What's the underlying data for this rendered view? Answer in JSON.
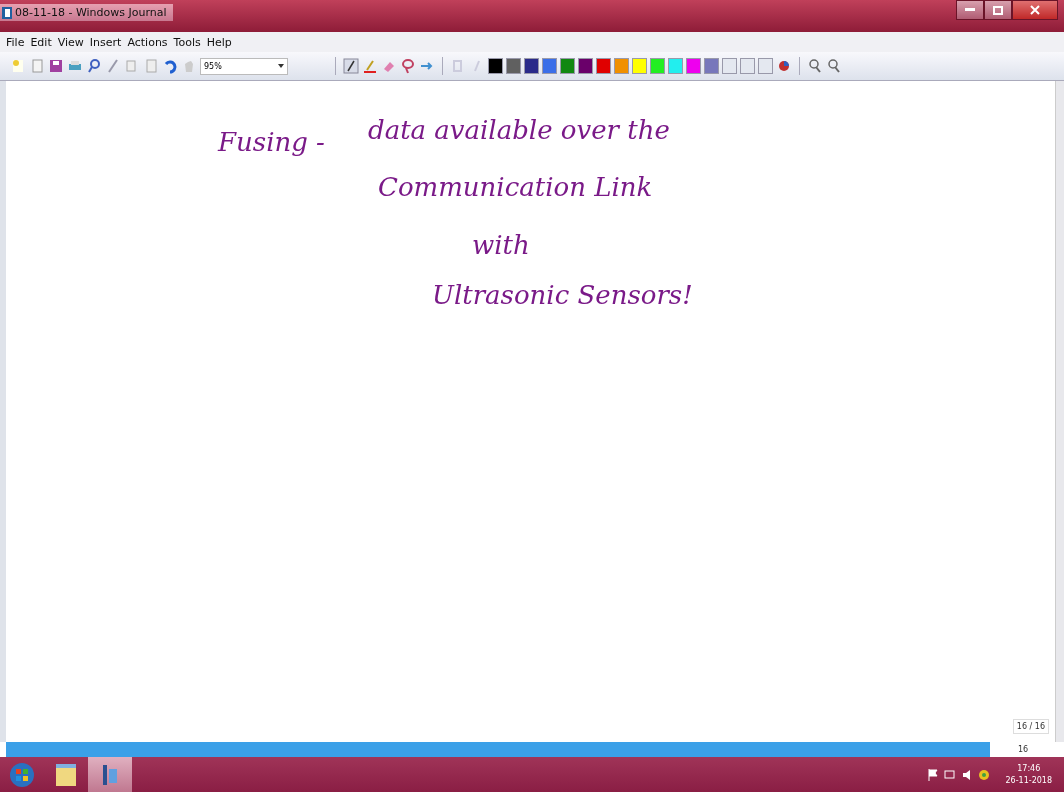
{
  "window": {
    "title": "08-11-18 - Windows Journal"
  },
  "menu": [
    "File",
    "Edit",
    "View",
    "Insert",
    "Actions",
    "Tools",
    "Help"
  ],
  "toolbar": {
    "zoom": "95%"
  },
  "palette": [
    {
      "color": "#000000"
    },
    {
      "color": "#606060"
    },
    {
      "color": "#2a2a8a"
    },
    {
      "color": "#3a6ee8"
    },
    {
      "color": "#118811"
    },
    {
      "color": "#6a006a"
    },
    {
      "color": "#e00000"
    },
    {
      "color": "#f09000"
    },
    {
      "color": "#ffff00"
    },
    {
      "color": "#22ee22"
    },
    {
      "color": "#22eeee"
    },
    {
      "color": "#ee00ee"
    },
    {
      "color": "#7777bb"
    },
    {
      "color": "#e4e8f0"
    },
    {
      "color": "#e4e8f0"
    },
    {
      "color": "#e4e8f0"
    }
  ],
  "ink": [
    {
      "text": "Fusing -"
    },
    {
      "text": "data available over the"
    },
    {
      "text": "Communication Link"
    },
    {
      "text": "with"
    },
    {
      "text": "Ultrasonic Sensors!"
    }
  ],
  "page_indicator": "16 / 16",
  "page_number": "16",
  "taskbar": {
    "time": "17:46",
    "date": "26-11-2018"
  }
}
